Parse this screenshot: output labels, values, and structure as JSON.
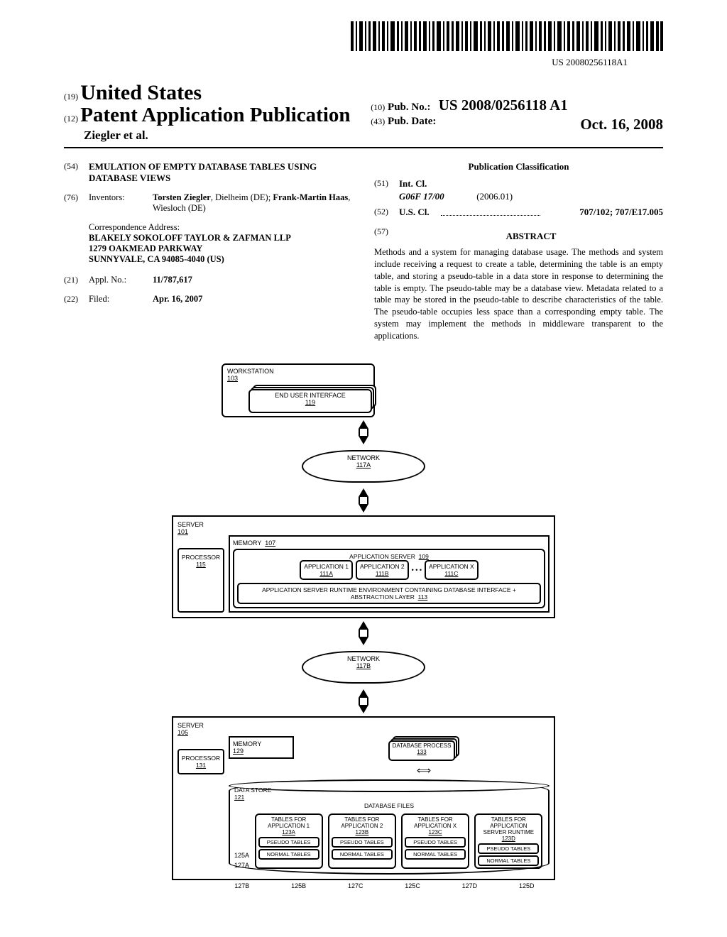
{
  "barcode_number": "US 20080256118A1",
  "header": {
    "code19": "(19)",
    "country": "United States",
    "code12": "(12)",
    "pub_type": "Patent Application Publication",
    "authors": "Ziegler et al.",
    "code10": "(10)",
    "pub_no_label": "Pub. No.:",
    "pub_no": "US 2008/0256118 A1",
    "code43": "(43)",
    "pub_date_label": "Pub. Date:",
    "pub_date": "Oct. 16, 2008"
  },
  "left": {
    "code54": "(54)",
    "title": "EMULATION OF EMPTY DATABASE TABLES USING DATABASE VIEWS",
    "code76": "(76)",
    "inventors_label": "Inventors:",
    "inventors": "Torsten Ziegler, Dielheim (DE); Frank-Martin Haas, Wiesloch (DE)",
    "corr_label": "Correspondence Address:",
    "corr_name": "BLAKELY SOKOLOFF TAYLOR & ZAFMAN LLP",
    "corr_street": "1279 OAKMEAD PARKWAY",
    "corr_city": "SUNNYVALE, CA 94085-4040 (US)",
    "code21": "(21)",
    "appl_label": "Appl. No.:",
    "appl_no": "11/787,617",
    "code22": "(22)",
    "filed_label": "Filed:",
    "filed": "Apr. 16, 2007"
  },
  "right": {
    "class_head": "Publication Classification",
    "code51": "(51)",
    "intcl_label": "Int. Cl.",
    "intcl_code": "G06F 17/00",
    "intcl_year": "(2006.01)",
    "code52": "(52)",
    "uscl_label": "U.S. Cl.",
    "uscl_val": "707/102; 707/E17.005",
    "code57": "(57)",
    "abs_head": "ABSTRACT",
    "abstract": "Methods and a system for managing database usage. The methods and system include receiving a request to create a table, determining the table is an empty table, and storing a pseudo-table in a data store in response to determining the table is empty. The pseudo-table may be a database view. Metadata related to a table may be stored in the pseudo-table to describe characteristics of the table. The pseudo-table occupies less space than a corresponding empty table. The system may implement the methods in middleware transparent to the applications."
  },
  "figure": {
    "workstation": "WORKSTATION",
    "workstation_ref": "103",
    "eui": "END USER INTERFACE",
    "eui_ref": "119",
    "network": "NETWORK",
    "net_a": "117A",
    "net_b": "117B",
    "server": "SERVER",
    "srv101": "101",
    "srv105": "105",
    "memory": "MEMORY",
    "mem107": "107",
    "mem129": "129",
    "processor": "PROCESSOR",
    "proc115": "115",
    "proc131": "131",
    "appserver": "APPLICATION SERVER",
    "appserver_ref": "109",
    "app1": "APPLICATION 1",
    "app1_ref": "111A",
    "app2": "APPLICATION 2",
    "app2_ref": "111B",
    "appx": "APPLICATION X",
    "appx_ref": "111C",
    "dots": "• • •",
    "runtime": "APPLICATION SERVER RUNTIME ENVIRONMENT CONTAINING DATABASE INTERFACE + ABSTRACTION LAYER",
    "runtime_ref": "113",
    "dbprocess": "DATABASE PROCESS",
    "dbprocess_ref": "133",
    "datastore": "DATA STORE",
    "datastore_ref": "121",
    "dbfiles": "DATABASE FILES",
    "tbl_app1": "TABLES FOR APPLICATION 1",
    "tbl_app1_ref": "123A",
    "tbl_app2": "TABLES FOR APPLICATION 2",
    "tbl_app2_ref": "123B",
    "tbl_appx": "TABLES FOR APPLICATION X",
    "tbl_appx_ref": "123C",
    "tbl_rt": "TABLES FOR APPLICATION SERVER RUNTIME",
    "tbl_rt_ref": "123D",
    "pseudo": "PSEUDO TABLES",
    "normal": "NORMAL TABLES",
    "c125a": "125A",
    "c127a": "127A",
    "c125b": "125B",
    "c127b": "127B",
    "c125c": "125C",
    "c127c": "127C",
    "c125d": "125D",
    "c127d": "127D"
  }
}
